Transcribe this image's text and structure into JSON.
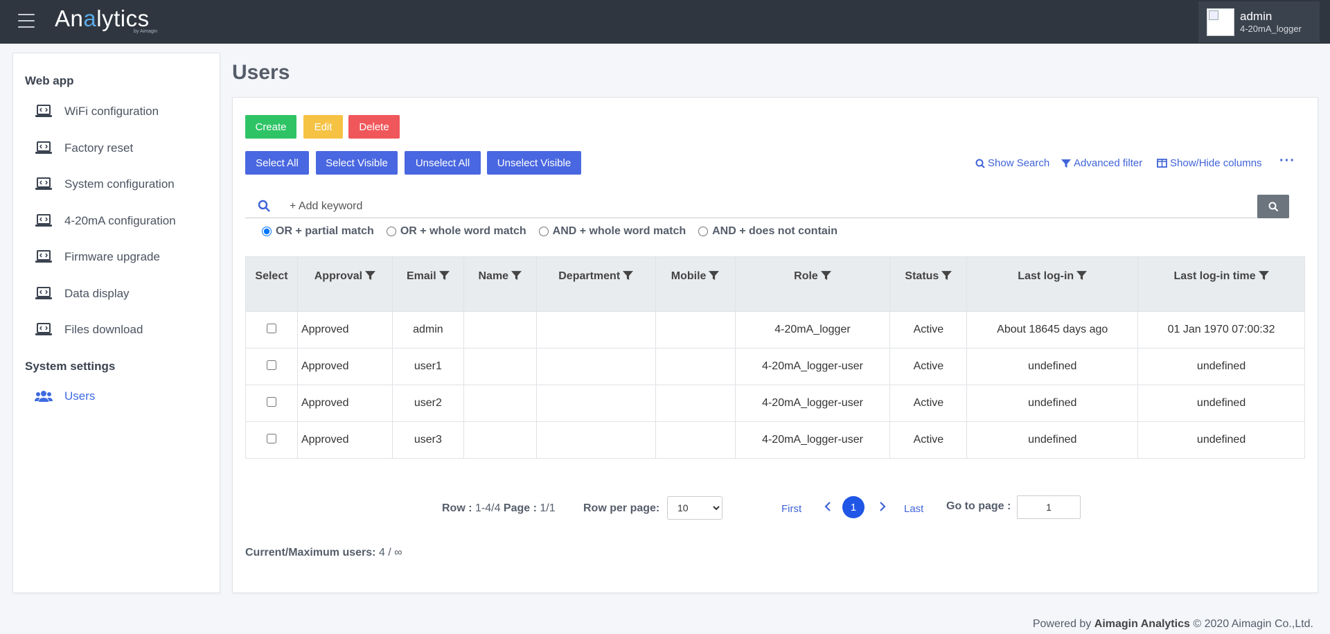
{
  "topbar": {
    "logo_pre": "An",
    "logo_accent": "a",
    "logo_post": "lytics",
    "logo_by": "by Aimagin",
    "user_name": "admin",
    "user_role": "4-20mA_logger"
  },
  "sidebar": {
    "heading_webapp": "Web app",
    "items": [
      {
        "label": "WiFi configuration"
      },
      {
        "label": "Factory reset"
      },
      {
        "label": "System configuration"
      },
      {
        "label": "4-20mA configuration"
      },
      {
        "label": "Firmware upgrade"
      },
      {
        "label": "Data display"
      },
      {
        "label": "Files download"
      }
    ],
    "heading_system": "System settings",
    "users_label": "Users"
  },
  "page": {
    "title": "Users"
  },
  "toolbar": {
    "create": "Create",
    "edit": "Edit",
    "delete": "Delete",
    "select_all": "Select All",
    "select_visible": "Select Visible",
    "unselect_all": "Unselect All",
    "unselect_visible": "Unselect Visible",
    "show_search": "Show Search",
    "advanced_filter": "Advanced filter",
    "show_hide_columns": "Show/Hide columns",
    "more": "···"
  },
  "search": {
    "placeholder": "+ Add keyword",
    "options": [
      "OR + partial match",
      "OR + whole word match",
      "AND + whole word match",
      "AND + does not contain"
    ]
  },
  "table": {
    "headers": [
      "Select",
      "Approval",
      "Email",
      "Name",
      "Department",
      "Mobile",
      "Role",
      "Status",
      "Last log-in",
      "Last log-in time"
    ],
    "rows": [
      {
        "approval": "Approved",
        "email": "admin",
        "name": "",
        "department": "",
        "mobile": "",
        "role": "4-20mA_logger",
        "status": "Active",
        "last_login": "About 18645 days ago",
        "last_login_time": "01 Jan 1970 07:00:32"
      },
      {
        "approval": "Approved",
        "email": "user1",
        "name": "",
        "department": "",
        "mobile": "",
        "role": "4-20mA_logger-user",
        "status": "Active",
        "last_login": "undefined",
        "last_login_time": "undefined"
      },
      {
        "approval": "Approved",
        "email": "user2",
        "name": "",
        "department": "",
        "mobile": "",
        "role": "4-20mA_logger-user",
        "status": "Active",
        "last_login": "undefined",
        "last_login_time": "undefined"
      },
      {
        "approval": "Approved",
        "email": "user3",
        "name": "",
        "department": "",
        "mobile": "",
        "role": "4-20mA_logger-user",
        "status": "Active",
        "last_login": "undefined",
        "last_login_time": "undefined"
      }
    ]
  },
  "pagination": {
    "row_label": "Row :",
    "row_value": "1-4/4",
    "page_label": "Page :",
    "page_value": "1/1",
    "per_page_label": "Row per page:",
    "per_page_value": "10",
    "first": "First",
    "last": "Last",
    "current": "1",
    "goto_label": "Go to page :",
    "goto_value": "1"
  },
  "users_count": {
    "label": "Current/Maximum users:",
    "value": "4 / ∞"
  },
  "footer": {
    "prefix": "Powered by",
    "brand": "Aimagin Analytics",
    "suffix": "© 2020 Aimagin Co.,Ltd."
  },
  "colors": {
    "topbar": "#2f3640",
    "create": "#2ec466",
    "edit": "#f6c244",
    "delete": "#f0575b",
    "primary": "#4967e0",
    "link": "#3f63d8"
  }
}
